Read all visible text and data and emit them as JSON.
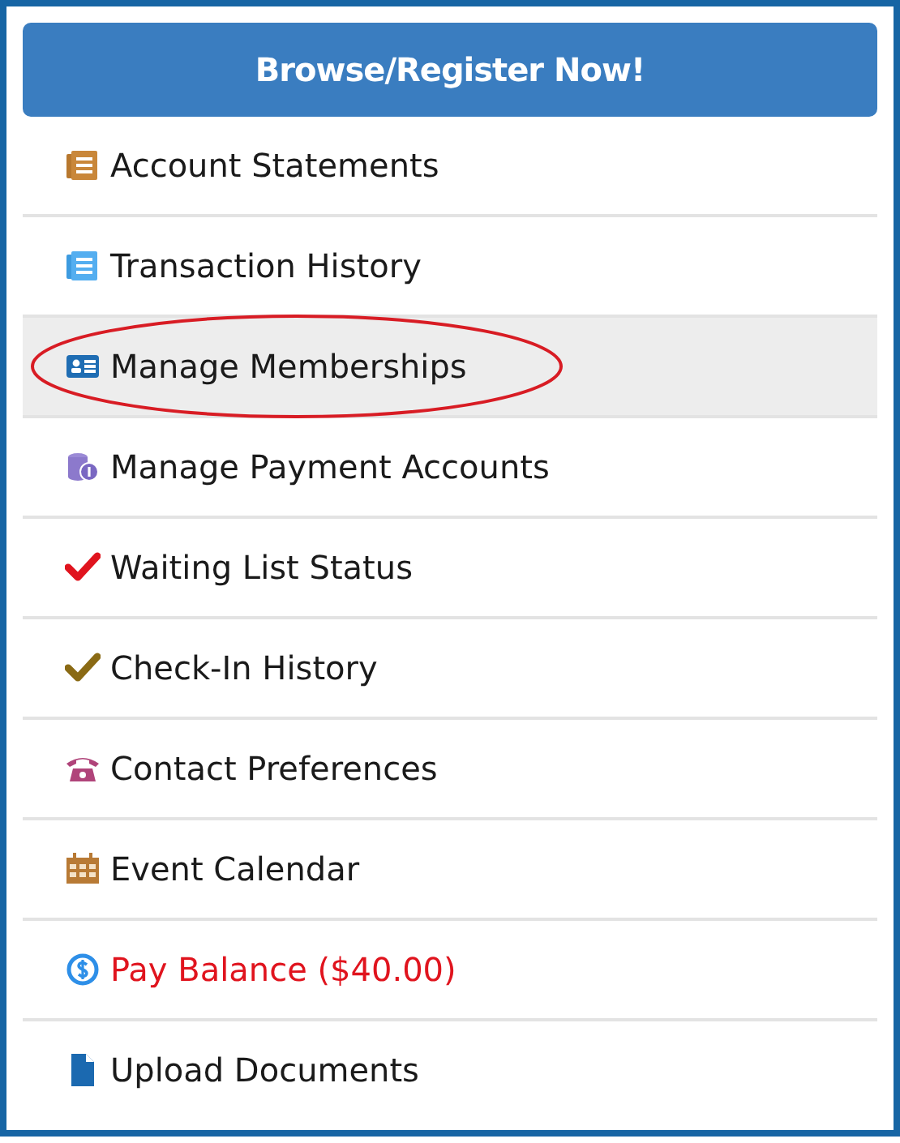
{
  "register_button": {
    "label": "Browse/Register Now!"
  },
  "menu": [
    {
      "label": "Account Statements",
      "kind": "statement",
      "selected": false,
      "circled": false,
      "alert": false
    },
    {
      "label": "Transaction History",
      "kind": "history",
      "selected": false,
      "circled": false,
      "alert": false
    },
    {
      "label": "Manage Memberships",
      "kind": "membership",
      "selected": true,
      "circled": true,
      "alert": false
    },
    {
      "label": "Manage Payment Accounts",
      "kind": "payment",
      "selected": false,
      "circled": false,
      "alert": false
    },
    {
      "label": "Waiting List Status",
      "kind": "waitlist",
      "selected": false,
      "circled": false,
      "alert": false
    },
    {
      "label": "Check-In History",
      "kind": "checkin",
      "selected": false,
      "circled": false,
      "alert": false
    },
    {
      "label": "Contact Preferences",
      "kind": "contact",
      "selected": false,
      "circled": false,
      "alert": false
    },
    {
      "label": "Event Calendar",
      "kind": "calendar",
      "selected": false,
      "circled": false,
      "alert": false
    },
    {
      "label": "Pay Balance ($40.00)",
      "kind": "balance",
      "selected": false,
      "circled": false,
      "alert": true
    },
    {
      "label": "Upload Documents",
      "kind": "upload",
      "selected": false,
      "circled": false,
      "alert": false
    }
  ]
}
